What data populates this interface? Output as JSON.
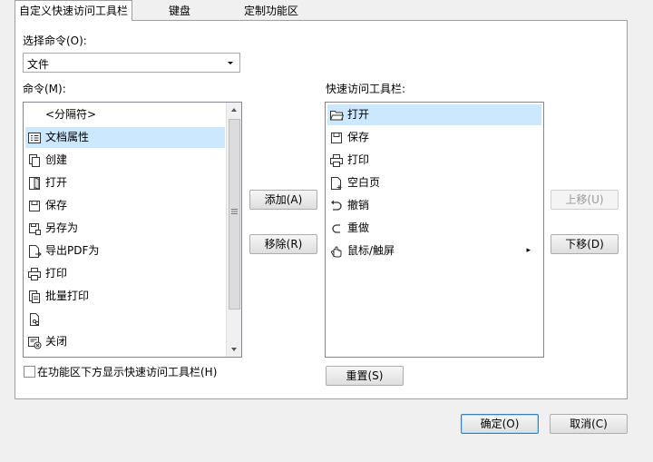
{
  "tabs": [
    {
      "label": "自定义快速访问工具栏",
      "active": true
    },
    {
      "label": "键盘",
      "active": false
    },
    {
      "label": "定制功能区",
      "active": false
    }
  ],
  "select_command": {
    "label": "选择命令(O):",
    "value": "文件"
  },
  "commands": {
    "label": "命令(M):",
    "items": [
      {
        "label": "<分隔符>",
        "icon": "none"
      },
      {
        "label": "文档属性",
        "icon": "properties-icon",
        "selected": true
      },
      {
        "label": "创建",
        "icon": "create-icon"
      },
      {
        "label": "打开",
        "icon": "open-icon"
      },
      {
        "label": "保存",
        "icon": "save-icon"
      },
      {
        "label": "另存为",
        "icon": "save-as-icon"
      },
      {
        "label": "导出PDF为",
        "icon": "export-pdf-icon"
      },
      {
        "label": "打印",
        "icon": "print-icon"
      },
      {
        "label": "批量打印",
        "icon": "batch-print-icon"
      },
      {
        "label": "",
        "icon": "document-link-icon"
      },
      {
        "label": "关闭",
        "icon": "close-document-icon"
      }
    ]
  },
  "quick_access": {
    "label": "快速访问工具栏:",
    "items": [
      {
        "label": "打开",
        "icon": "open-folder-icon",
        "selected": true
      },
      {
        "label": "保存",
        "icon": "save-icon"
      },
      {
        "label": "打印",
        "icon": "print-icon"
      },
      {
        "label": "空白页",
        "icon": "blank-page-icon"
      },
      {
        "label": "撤销",
        "icon": "undo-icon"
      },
      {
        "label": "重做",
        "icon": "redo-icon"
      },
      {
        "label": "鼠标/触屏",
        "icon": "hand-icon",
        "submenu_glyph": "▸"
      }
    ]
  },
  "buttons": {
    "add": "添加(A)",
    "remove": "移除(R)",
    "move_up": "上移(U)",
    "move_down": "下移(D)",
    "reset": "重置(S)",
    "ok": "确定(O)",
    "cancel": "取消(C)"
  },
  "show_below_ribbon": {
    "label": "在功能区下方显示快速访问工具栏(H)",
    "checked": false
  }
}
